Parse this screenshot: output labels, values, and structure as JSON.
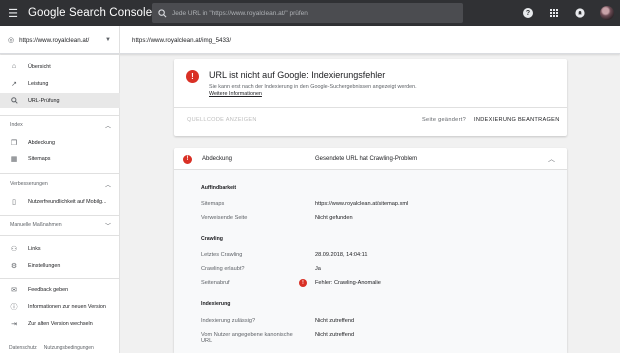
{
  "app": {
    "title": "Google Search Console"
  },
  "search": {
    "placeholder": "Jede URL in \"https://www.royalclean.at/\" prüfen"
  },
  "property": {
    "name": "https://www.royalclean.at/"
  },
  "current_url": "https://www.royalclean.at/img_5433/",
  "sidebar": {
    "items_top": [
      {
        "label": "Übersicht",
        "icon": "home-icon"
      },
      {
        "label": "Leistung",
        "icon": "trending-icon"
      },
      {
        "label": "URL-Prüfung",
        "icon": "search-icon"
      }
    ],
    "section_index": "Index",
    "items_index": [
      {
        "label": "Abdeckung",
        "icon": "file-copy-icon"
      },
      {
        "label": "Sitemaps",
        "icon": "sitemap-icon"
      }
    ],
    "section_improvements": "Verbesserungen",
    "items_improvements": [
      {
        "label": "Nutzerfreundlichkeit auf Mobilg...",
        "icon": "phone-icon"
      }
    ],
    "section_manual": "Manuelle Maßnahmen",
    "items_bottom": [
      {
        "label": "Links",
        "icon": "links-icon"
      },
      {
        "label": "Einstellungen",
        "icon": "gear-icon"
      }
    ],
    "items_feedback": [
      {
        "label": "Feedback geben",
        "icon": "feedback-icon"
      },
      {
        "label": "Informationen zur neuen Version",
        "icon": "info-icon"
      },
      {
        "label": "Zur alten Version wechseln",
        "icon": "exit-icon"
      }
    ],
    "footer": {
      "privacy": "Datenschutz",
      "terms": "Nutzungsbedingungen"
    }
  },
  "status_card": {
    "title": "URL ist nicht auf Google: Indexierungsfehler",
    "description": "Sie kann erst nach der Indexierung in den Google-Suchergebnissen angezeigt werden.",
    "link": "Weitere Informationen",
    "btn_source": "QUELLCODE ANZEIGEN",
    "btn_changed": "Seite geändert?",
    "btn_request": "INDEXIERUNG BEANTRAGEN"
  },
  "coverage": {
    "label": "Abdeckung",
    "value": "Gesendete URL hat Crawling-Problem",
    "sections": {
      "discovery": {
        "heading": "Auffindbarkeit",
        "rows": [
          {
            "key": "Sitemaps",
            "value": "https://www.royalclean.at/sitemap.xml"
          },
          {
            "key": "Verweisende Seite",
            "value": "Nicht gefunden"
          }
        ]
      },
      "crawling": {
        "heading": "Crawling",
        "rows": [
          {
            "key": "Letztes Crawling",
            "value": "28.09.2018, 14:04:11"
          },
          {
            "key": "Crawling erlaubt?",
            "value": "Ja"
          },
          {
            "key": "Seitenabruf",
            "value": "Fehler: Crawling-Anomalie"
          }
        ]
      },
      "indexing": {
        "heading": "Indexierung",
        "rows": [
          {
            "key": "Indexierung zulässig?",
            "value": "Nicht zutreffend"
          },
          {
            "key": "Vom Nutzer angegebene kanonische URL",
            "value": "Nicht zutreffend"
          }
        ]
      }
    }
  },
  "colors": {
    "topbar": "#303134",
    "error": "#d93025",
    "accent": "#202124"
  }
}
